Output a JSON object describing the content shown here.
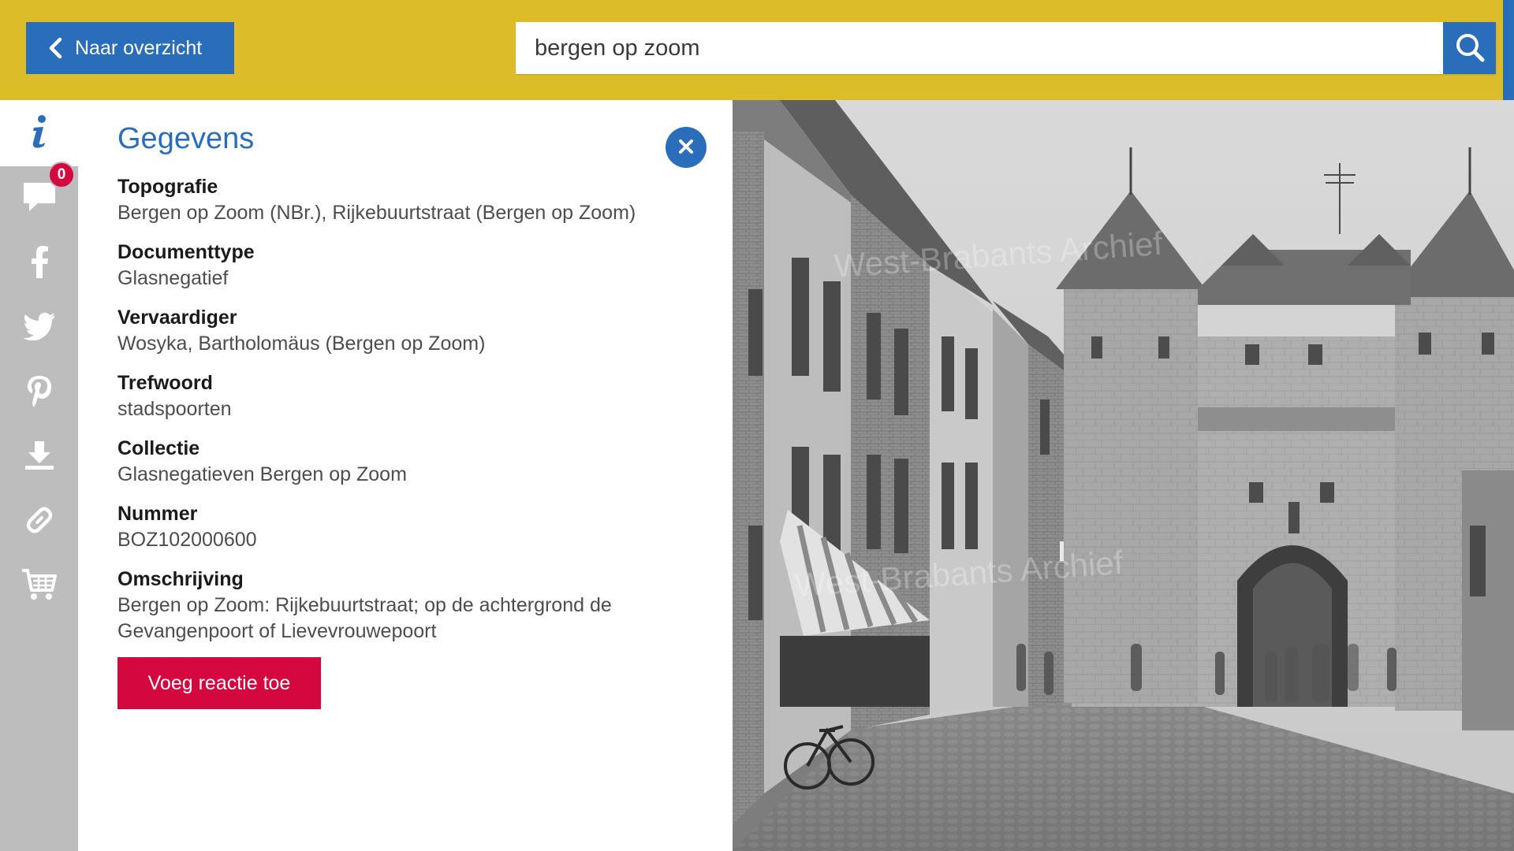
{
  "header": {
    "back_label": "Naar overzicht",
    "search_value": "bergen op zoom",
    "search_icon": "search-icon",
    "back_icon": "chevron-left-icon"
  },
  "rail": {
    "items": [
      {
        "icon": "info-icon"
      },
      {
        "icon": "comment-icon",
        "badge": "0"
      },
      {
        "icon": "facebook-icon"
      },
      {
        "icon": "twitter-icon"
      },
      {
        "icon": "pinterest-icon"
      },
      {
        "icon": "download-icon"
      },
      {
        "icon": "link-icon"
      },
      {
        "icon": "cart-icon"
      }
    ]
  },
  "panel": {
    "title": "Gegevens",
    "fields": [
      {
        "label": "Topografie",
        "value": "Bergen op Zoom (NBr.), Rijkebuurtstraat (Bergen op Zoom)"
      },
      {
        "label": "Documenttype",
        "value": "Glasnegatief"
      },
      {
        "label": "Vervaardiger",
        "value": "Wosyka, Bartholomäus (Bergen op Zoom)"
      },
      {
        "label": "Trefwoord",
        "value": "stadspoorten"
      },
      {
        "label": "Collectie",
        "value": "Glasnegatieven Bergen op Zoom"
      },
      {
        "label": "Nummer",
        "value": "BOZ102000600"
      },
      {
        "label": "Omschrijving",
        "value": "Bergen op Zoom: Rijkebuurtstraat; op de achtergrond de Gevangenpoort of Lievevrouwepoort"
      }
    ],
    "add_reaction_label": "Voeg reactie toe"
  },
  "photo": {
    "watermark": "West-Brabants Archief"
  },
  "colors": {
    "header_yellow": "#dcbd29",
    "primary_blue": "#2a6ebb",
    "accent_red": "#d4083f",
    "rail_grey": "#bdbdbd"
  }
}
